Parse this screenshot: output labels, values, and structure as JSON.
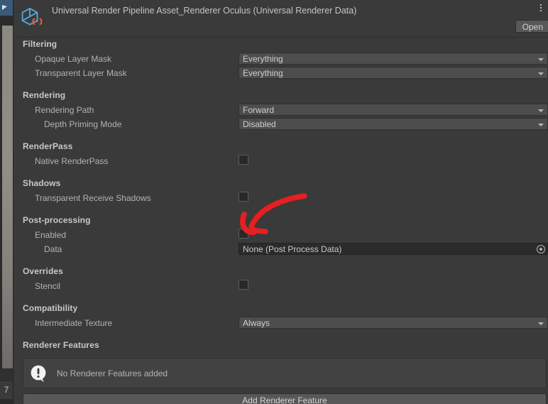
{
  "window": {
    "title": "Universal Render Pipeline Asset_Renderer Oculus (Universal Renderer Data)",
    "icon": "unity-scriptable-object-icon",
    "open_button": "Open",
    "kebab_menu": "more-options-icon"
  },
  "left_pane": {
    "bottom_label": "7"
  },
  "sections": [
    {
      "header": "Filtering",
      "rows": [
        {
          "label": "Opaque Layer Mask",
          "indent": 1,
          "control": "dropdown",
          "value": "Everything"
        },
        {
          "label": "Transparent Layer Mask",
          "indent": 1,
          "control": "dropdown",
          "value": "Everything"
        }
      ]
    },
    {
      "header": "Rendering",
      "rows": [
        {
          "label": "Rendering Path",
          "indent": 1,
          "control": "dropdown",
          "value": "Forward"
        },
        {
          "label": "Depth Priming Mode",
          "indent": 2,
          "control": "dropdown",
          "value": "Disabled"
        }
      ]
    },
    {
      "header": "RenderPass",
      "rows": [
        {
          "label": "Native RenderPass",
          "indent": 1,
          "control": "checkbox",
          "checked": false
        }
      ]
    },
    {
      "header": "Shadows",
      "rows": [
        {
          "label": "Transparent Receive Shadows",
          "indent": 1,
          "control": "checkbox",
          "checked": false
        }
      ]
    },
    {
      "header": "Post-processing",
      "rows": [
        {
          "label": "Enabled",
          "indent": 1,
          "control": "checkbox",
          "checked": false
        },
        {
          "label": "Data",
          "indent": 2,
          "control": "object",
          "value": "None (Post Process Data)"
        }
      ]
    },
    {
      "header": "Overrides",
      "rows": [
        {
          "label": "Stencil",
          "indent": 1,
          "control": "checkbox",
          "checked": false
        }
      ]
    },
    {
      "header": "Compatibility",
      "rows": [
        {
          "label": "Intermediate Texture",
          "indent": 1,
          "control": "dropdown",
          "value": "Always"
        }
      ]
    },
    {
      "header": "Renderer Features",
      "rows": []
    }
  ],
  "help_box": {
    "icon": "info-bubble-icon",
    "message": "No Renderer Features added"
  },
  "add_button": {
    "label": "Add Renderer Feature"
  },
  "annotation": {
    "type": "curved-arrow",
    "color": "#e81f20",
    "points_to": "post-processing-enabled-checkbox"
  },
  "colors": {
    "panel_bg": "#3a3a3a",
    "dropdown_bg": "#4d4d4d",
    "object_field_bg": "#2b2b2b",
    "checkbox_bg": "#282828",
    "button_bg": "#585858",
    "text": "#b3b3b3",
    "header_text": "#c8c8c8",
    "annotation_red": "#e81f20"
  }
}
